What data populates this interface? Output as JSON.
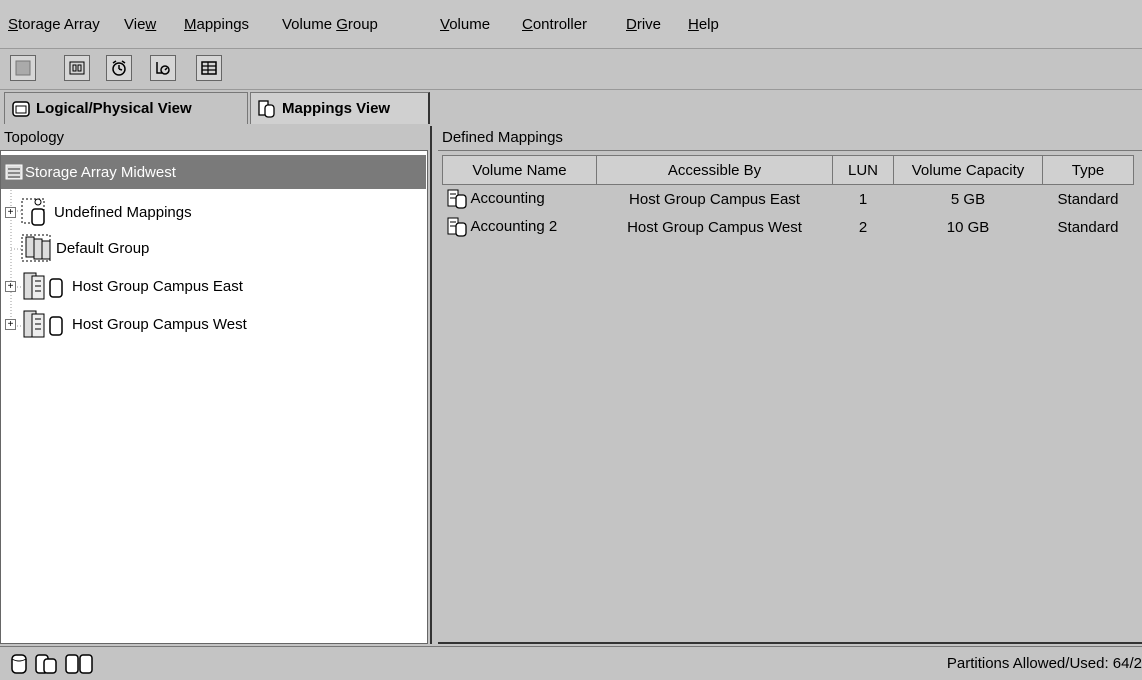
{
  "menu": [
    {
      "mnemonic": "S",
      "rest": "torage Array",
      "pre": ""
    },
    {
      "pre": "Vie",
      "mnemonic": "w",
      "rest": ""
    },
    {
      "pre": "",
      "mnemonic": "M",
      "rest": "appings"
    },
    {
      "pre": "Volume ",
      "mnemonic": "G",
      "rest": "roup"
    },
    {
      "pre": "",
      "mnemonic": "V",
      "rest": "olume"
    },
    {
      "pre": "",
      "mnemonic": "C",
      "rest": "ontroller"
    },
    {
      "pre": "",
      "mnemonic": "D",
      "rest": "rive"
    },
    {
      "pre": "",
      "mnemonic": "H",
      "rest": "elp"
    }
  ],
  "toolbar": {
    "icons": [
      "storage-array-icon",
      "volume-icon",
      "clock-icon",
      "performance-icon",
      "table-icon"
    ]
  },
  "tabs": {
    "logical": "Logical/Physical View",
    "mappings": "Mappings View"
  },
  "topology": {
    "header": "Topology",
    "root": "Storage Array Midwest",
    "items": [
      {
        "label": "Undefined Mappings",
        "expander": "+"
      },
      {
        "label": "Default Group",
        "expander": ""
      },
      {
        "label": "Host Group Campus East",
        "expander": "+"
      },
      {
        "label": "Host Group Campus West",
        "expander": "+"
      }
    ]
  },
  "mappings": {
    "header": "Defined Mappings",
    "columns": [
      "Volume Name",
      "Accessible By",
      "LUN",
      "Volume Capacity",
      "Type"
    ],
    "rows": [
      [
        "Accounting",
        "Host Group Campus East",
        "1",
        "5 GB",
        "Standard"
      ],
      [
        "Accounting 2",
        "Host Group Campus West",
        "2",
        "10 GB",
        "Standard"
      ]
    ]
  },
  "status": {
    "text": "Partitions Allowed/Used: 64/2"
  },
  "colors": {
    "background": "#c4c4c4",
    "selected": "#7a7a7a"
  }
}
